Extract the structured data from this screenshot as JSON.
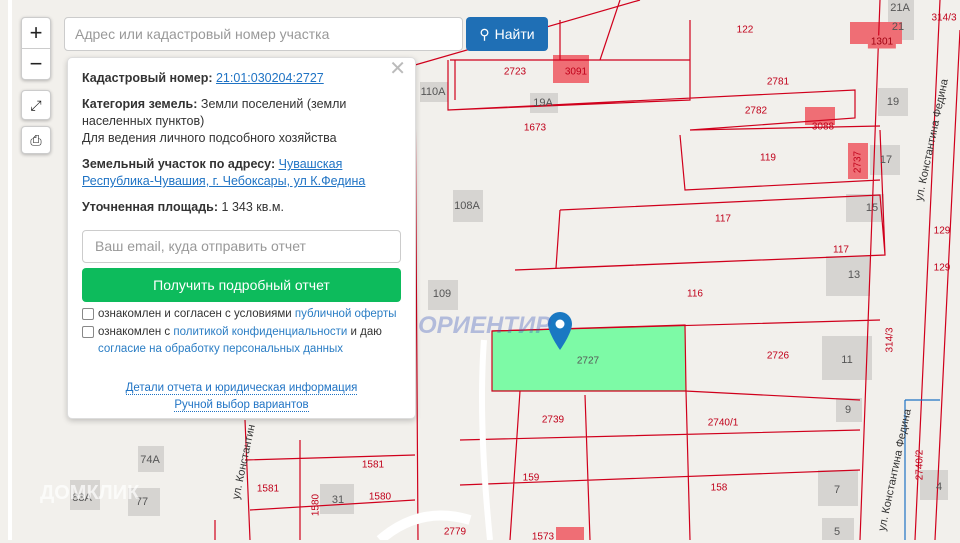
{
  "search": {
    "placeholder": "Адрес или кадастровый номер участка",
    "button": "Найти"
  },
  "controls": {
    "zoom_in": "+",
    "zoom_out": "−"
  },
  "popup": {
    "cadastral_label": "Кадастровый номер:",
    "cadastral_value": "21:01:030204:2727",
    "category_label": "Категория земель:",
    "category_value": "Земли поселений (земли населенных пунктов)",
    "usage": "Для ведения личного подсобного хозяйства",
    "address_label": "Земельный участок по адресу:",
    "address_value": "Чувашская Республика-Чувашия, г. Чебоксары, ул К.Федина",
    "area_label": "Уточненная площадь:",
    "area_value": "1 343 кв.м.",
    "email_placeholder": "Ваш email, куда отправить отчет",
    "get_report": "Получить подробный отчет",
    "check1_text": "ознакомлен и согласен с условиями",
    "check1_link": "публичной оферты",
    "check2_text": "ознакомлен с",
    "check2_link": "политикой конфиденциальности",
    "check2_mid": "и даю",
    "check2_link2": "согласие на обработку персональных данных",
    "details_link": "Детали отчета и юридическая информация",
    "manual_link": "Ручной выбор вариантов"
  },
  "map": {
    "labels": [
      "122",
      "1301",
      "2723",
      "3091",
      "2781",
      "110А",
      "19А",
      "19",
      "2782",
      "3088",
      "1673",
      "119",
      "17",
      "2737",
      "108А",
      "15",
      "117",
      "117",
      "129",
      "129",
      "13",
      "109",
      "116",
      "2727",
      "2726",
      "11",
      "9",
      "2739",
      "2740/1",
      "74А",
      "1581",
      "159",
      "158",
      "83А",
      "77",
      "1581",
      "1580",
      "31",
      "1580",
      "7",
      "2779",
      "1573",
      "5",
      "4",
      "314/3",
      "2740/2",
      "314/3",
      "21А",
      "21"
    ],
    "streets": [
      "ул. Константина Федина",
      "ул. Константина Федина",
      "ул. Константин"
    ],
    "watermarks": [
      "ОРИЕНТИР",
      "ДОМКЛИК"
    ]
  },
  "colors": {
    "parcel_line": "#d0001c",
    "selected_parcel": "#7dfaa6",
    "accent": "#1f6fb5",
    "button_green": "#0dbb5c"
  }
}
